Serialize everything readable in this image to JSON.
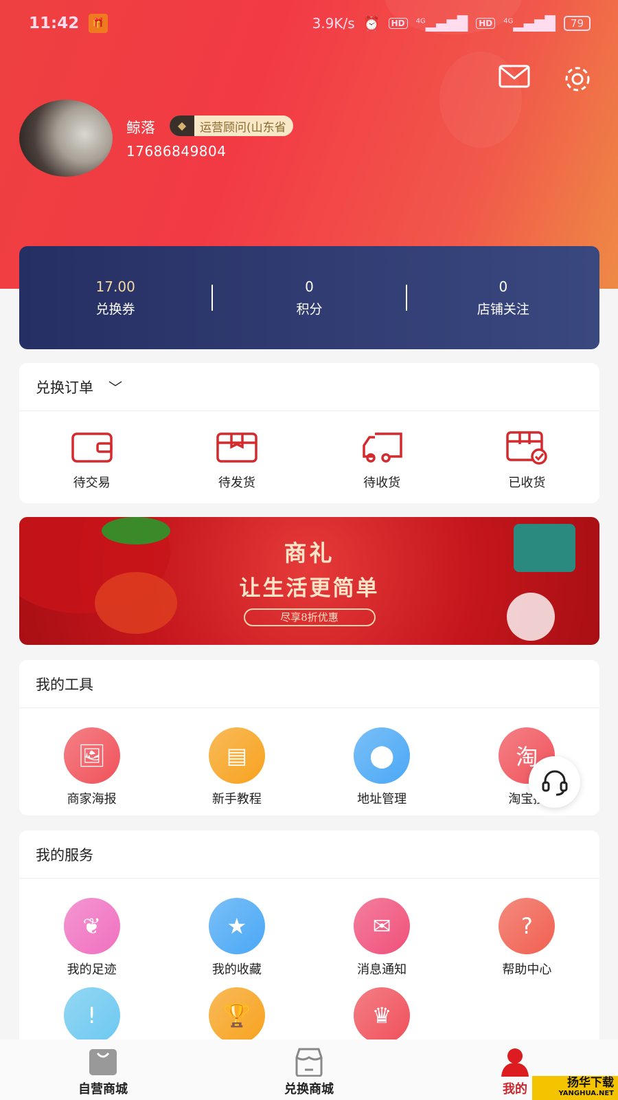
{
  "status_bar": {
    "time": "11:42",
    "notif_icon": "gift-icon",
    "network_speed": "3.9K/s",
    "hd1": "HD",
    "hd2": "HD",
    "net1": "4G",
    "net2": "4G",
    "battery": "79"
  },
  "header": {
    "mail_icon": "mail-icon",
    "settings_icon": "gear-icon"
  },
  "profile": {
    "name": "鲸落",
    "badge": "运营顾问(山东省",
    "phone": "17686849804"
  },
  "stats": [
    {
      "value": "17.00",
      "label": "兑换券"
    },
    {
      "value": "0",
      "label": "积分"
    },
    {
      "value": "0",
      "label": "店铺关注"
    }
  ],
  "orders": {
    "title": "兑换订单",
    "items": [
      {
        "label": "待交易",
        "icon": "wallet-icon"
      },
      {
        "label": "待发货",
        "icon": "box-icon"
      },
      {
        "label": "待收货",
        "icon": "truck-icon"
      },
      {
        "label": "已收货",
        "icon": "received-box-icon"
      }
    ]
  },
  "banner": {
    "title": "商礼",
    "subtitle": "让生活更简单",
    "cta": "尽享8折优惠"
  },
  "tools": {
    "title": "我的工具",
    "items": [
      {
        "label": "商家海报",
        "icon": "image-icon",
        "color": "#f0525a"
      },
      {
        "label": "新手教程",
        "icon": "book-icon",
        "color": "#f7a21e"
      },
      {
        "label": "地址管理",
        "icon": "location-icon",
        "color": "#4aa8f5"
      },
      {
        "label": "淘宝授",
        "icon": "taobao-icon",
        "glyph": "淘",
        "color": "#f0525a"
      }
    ]
  },
  "services": {
    "title": "我的服务",
    "items": [
      {
        "label": "我的足迹",
        "icon": "footprint-icon",
        "color": "#f070c0"
      },
      {
        "label": "我的收藏",
        "icon": "star-icon",
        "color": "#4aa8f5"
      },
      {
        "label": "消息通知",
        "icon": "mail-icon",
        "color": "#f0507a"
      },
      {
        "label": "帮助中心",
        "icon": "help-icon",
        "glyph": "?",
        "color": "#f06050"
      },
      {
        "label": "",
        "icon": "exclamation-icon",
        "glyph": "!",
        "color": "#6cc8f0"
      },
      {
        "label": "",
        "icon": "trophy-icon",
        "color": "#f7a21e"
      },
      {
        "label": "",
        "icon": "crown-icon",
        "color": "#f0505a"
      }
    ]
  },
  "nav": [
    {
      "label": "自营商城",
      "icon": "shopping-bag-icon"
    },
    {
      "label": "兑换商城",
      "icon": "store-icon"
    },
    {
      "label": "我的",
      "icon": "user-icon",
      "active": true
    }
  ],
  "colors": {
    "accent": "#e8222a",
    "stats_bg": "#2b3568"
  },
  "watermark": {
    "text": "扬华下载",
    "sub": "YANGHUA.NET"
  }
}
